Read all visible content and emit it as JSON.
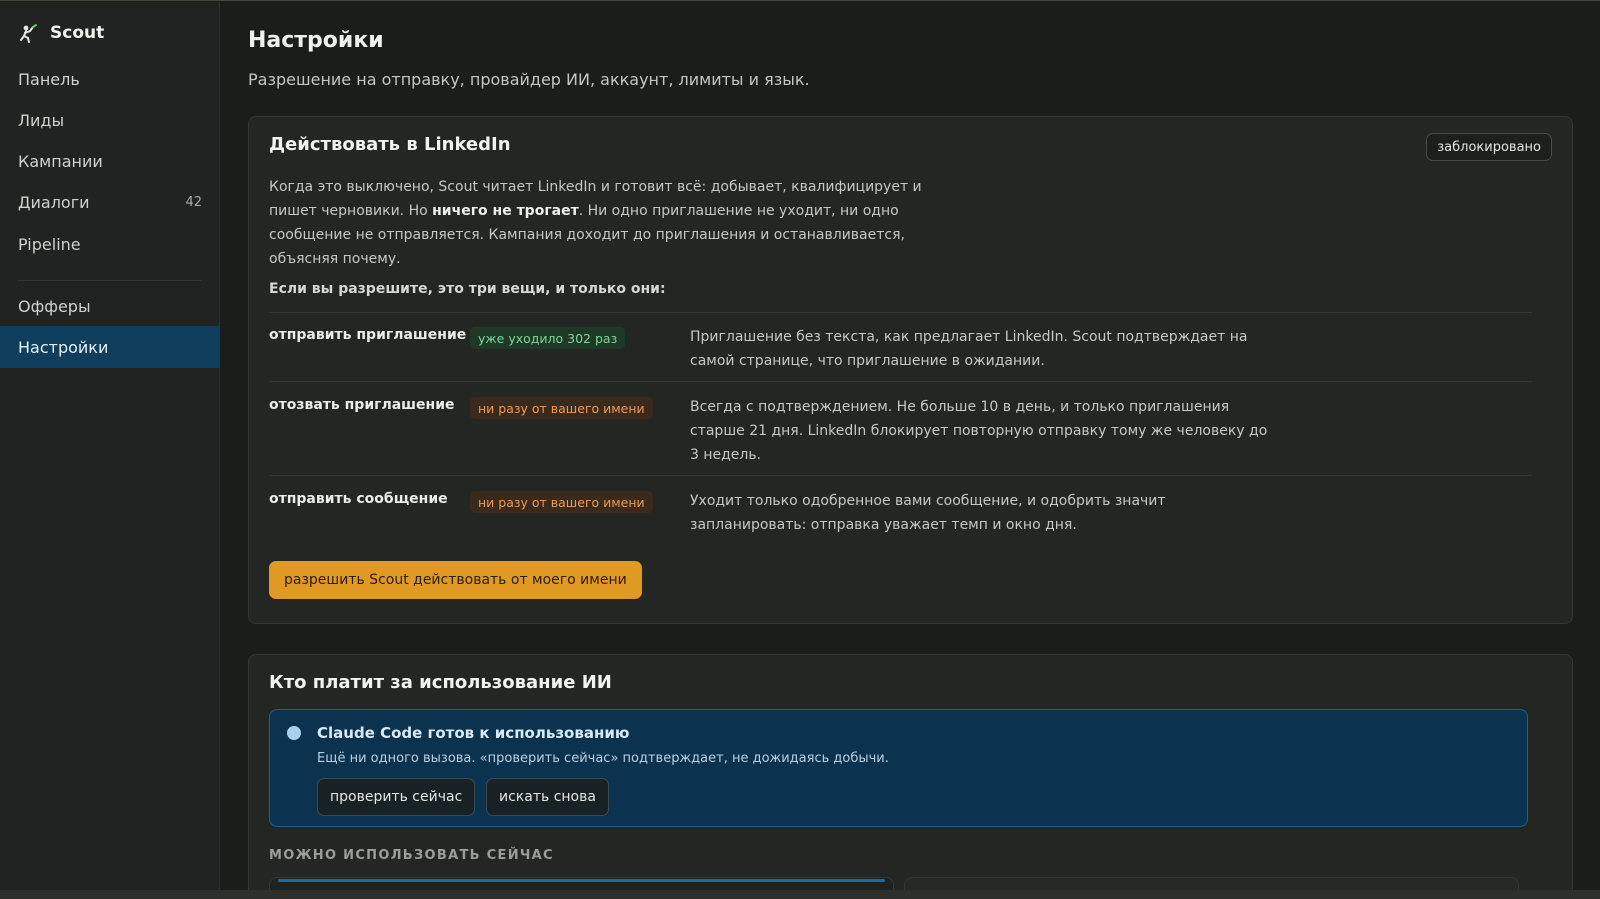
{
  "brand": {
    "name": "Scout",
    "logo_icon": "scout-logo-icon"
  },
  "sidebar": {
    "items": [
      {
        "label": "Панель",
        "count": ""
      },
      {
        "label": "Лиды",
        "count": ""
      },
      {
        "label": "Кампании",
        "count": ""
      },
      {
        "label": "Диалоги",
        "count": "42"
      },
      {
        "label": "Pipeline",
        "count": ""
      },
      {
        "label": "Офферы",
        "count": ""
      },
      {
        "label": "Настройки",
        "count": "",
        "active": true
      }
    ]
  },
  "page": {
    "title": "Настройки",
    "subtitle": "Разрешение на отправку, провайдер ИИ, аккаунт, лимиты и язык."
  },
  "linkedin_card": {
    "title": "Действовать в LinkedIn",
    "status_badge": "заблокировано",
    "desc_part1": "Когда это выключено, Scout читает LinkedIn и готовит всё: добывает, квалифицирует и пишет черновики. Но ",
    "desc_bold": "ничего не трогает",
    "desc_part2": ". Ни одно приглашение не уходит, ни одно сообщение не отправляется. Кампания доходит до приглашения и останавливается, объясняя почему.",
    "lead": "Если вы разрешите, это три вещи, и только они:",
    "actions": [
      {
        "name": "отправить приглашение",
        "pill": "уже уходило 302 раз",
        "text": "Приглашение без текста, как предлагает LinkedIn. Scout подтверждает на самой странице, что приглашение в ожидании."
      },
      {
        "name": "отозвать приглашение",
        "pill": "ни разу от вашего имени",
        "text": "Всегда с подтверждением. Не больше 10 в день, и только приглашения старше 21 дня. LinkedIn блокирует повторную отправку тому же человеку до 3 недель."
      },
      {
        "name": "отправить сообщение",
        "pill": "ни разу от вашего имени",
        "text": "Уходит только одобренное вами сообщение, и одобрить значит запланировать: отправка уважает темп и окно дня."
      }
    ],
    "allow_button": "разрешить Scout действовать от моего имени"
  },
  "ai_card": {
    "title": "Кто платит за использование ИИ",
    "provider": {
      "title": "Claude Code готов к использованию",
      "subtitle": "Ещё ни одного вызова. «проверить сейчас» подтверждает, не дожидаясь добычи.",
      "check_button": "проверить сейчас",
      "rescan_button": "искать снова"
    },
    "available_label": "МОЖНО ИСПОЛЬЗОВАТЬ СЕЙЧАС"
  },
  "colors": {
    "accent": "#e09a24",
    "active_nav": "#0f3d5c",
    "pill_green": "#7fd39a",
    "pill_orange": "#ef9a52",
    "provider_bg": "#0b3350"
  }
}
